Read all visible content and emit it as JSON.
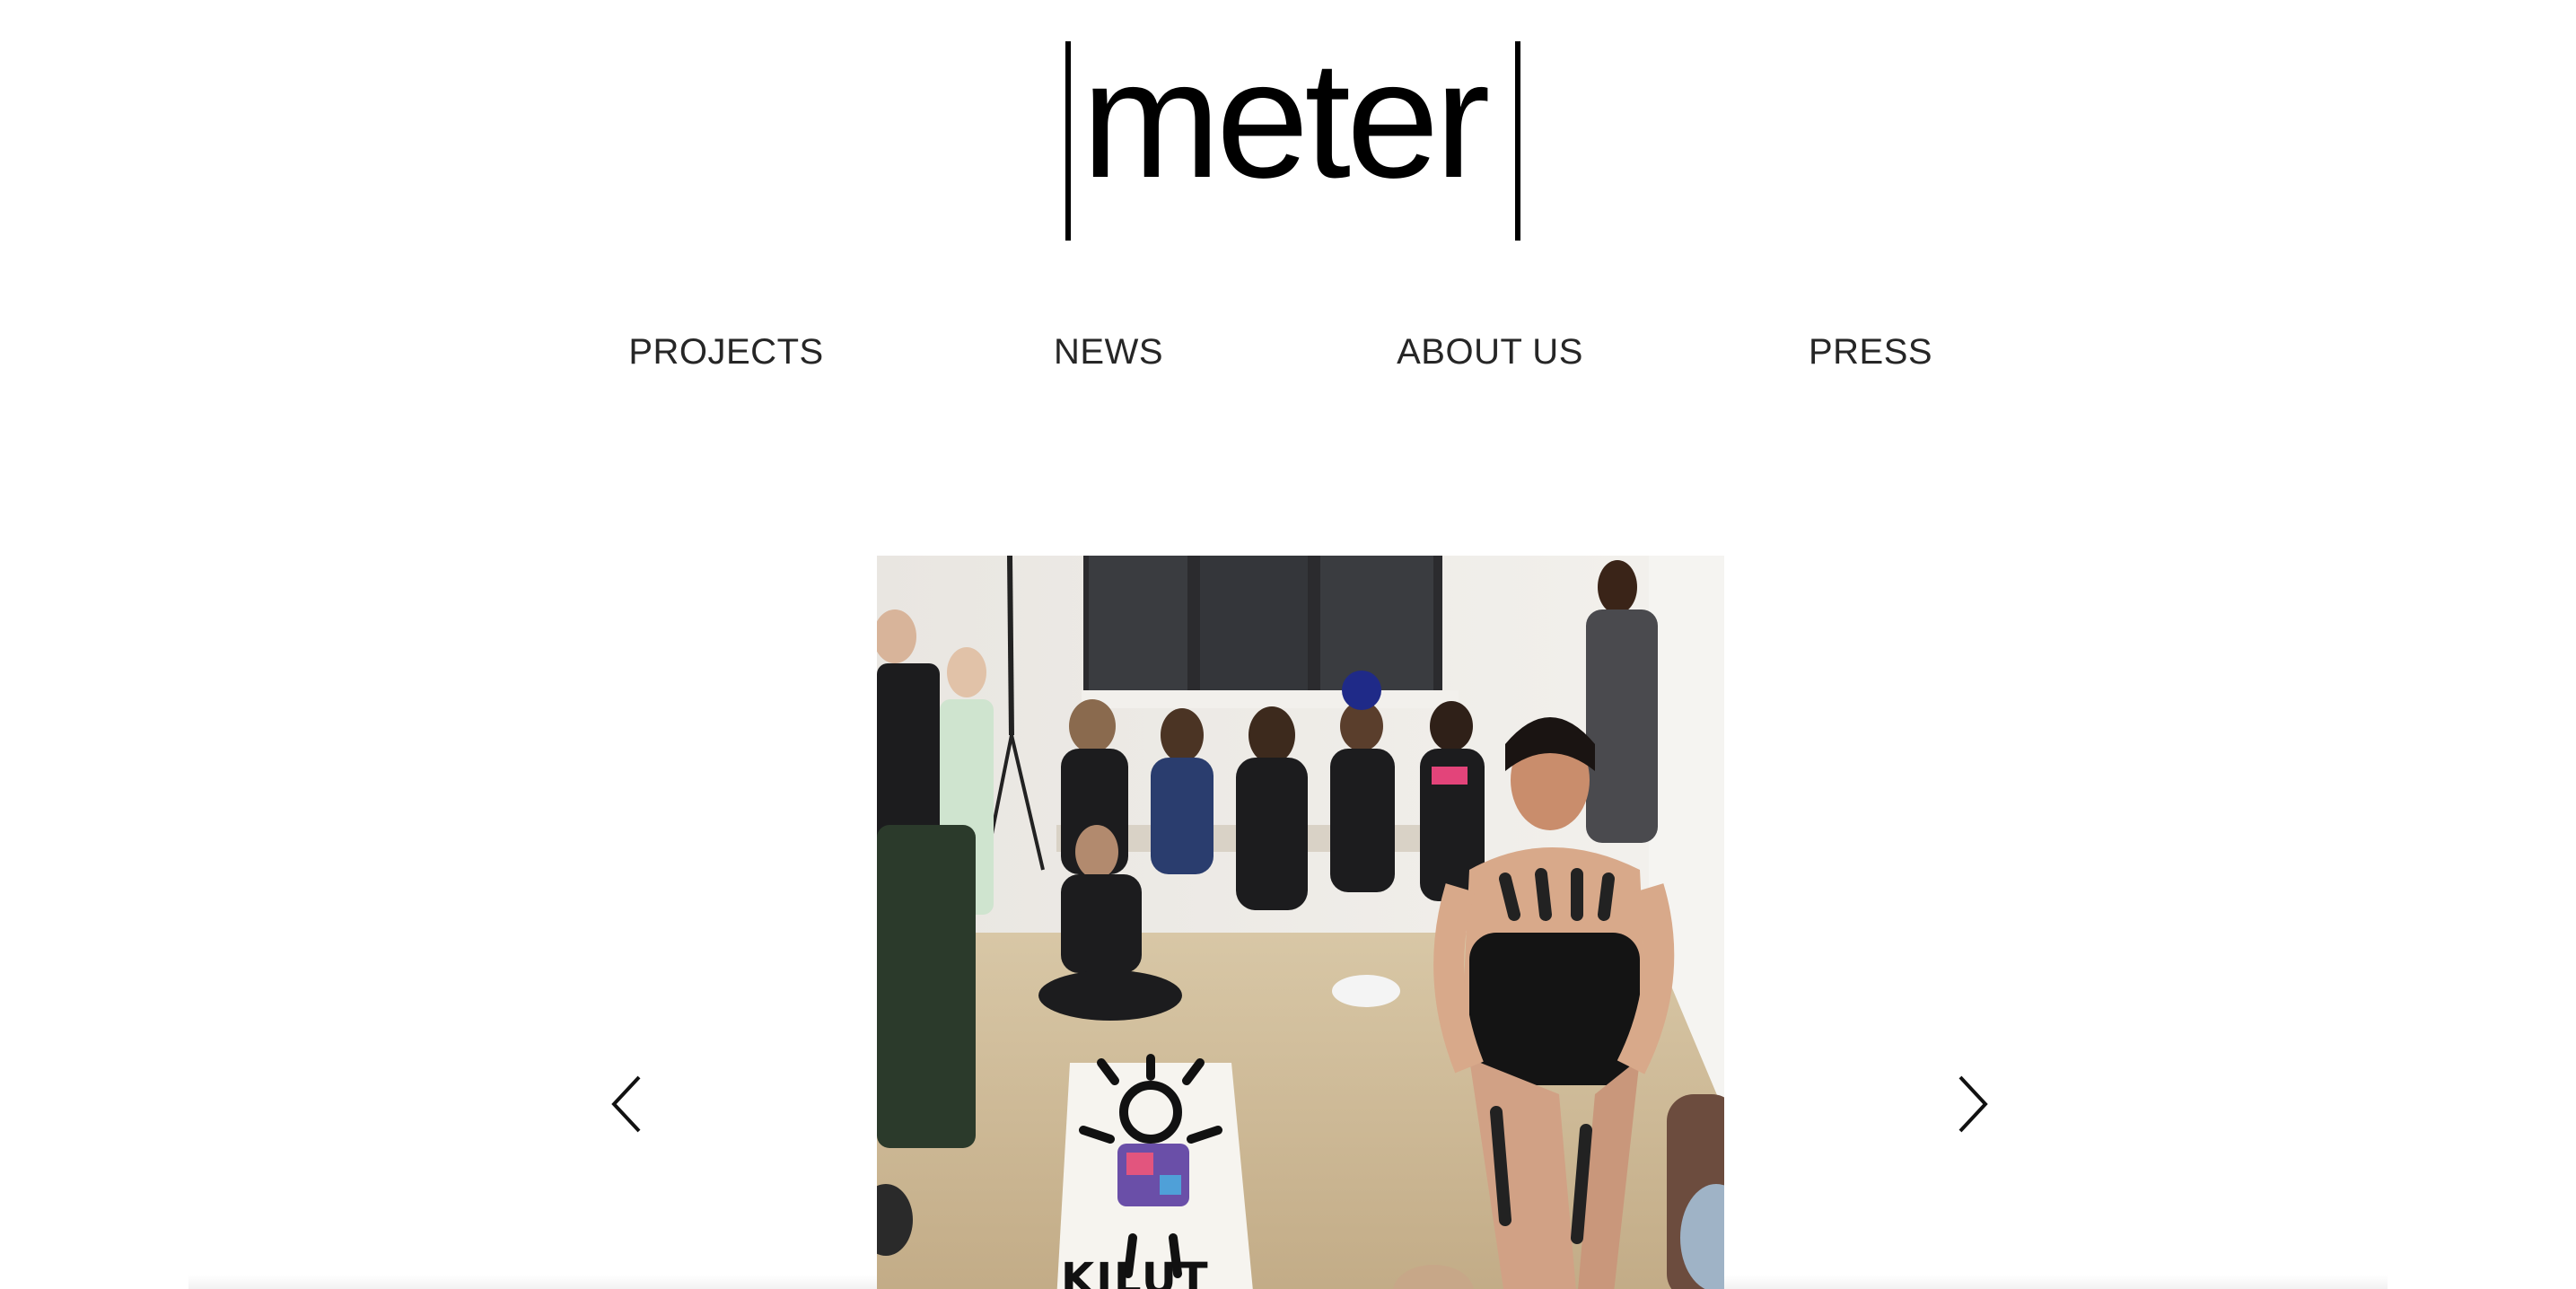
{
  "brand": {
    "logo_text": "meter"
  },
  "nav": {
    "items": [
      {
        "label": "PROJECTS"
      },
      {
        "label": "NEWS"
      },
      {
        "label": "ABOUT US"
      },
      {
        "label": "PRESS"
      }
    ]
  },
  "slider": {
    "prev_icon": "chevron-left-icon",
    "next_icon": "chevron-right-icon",
    "image_sign_text": "KILUT"
  },
  "colors": {
    "text": "#262626",
    "logo": "#000000",
    "background": "#ffffff"
  }
}
